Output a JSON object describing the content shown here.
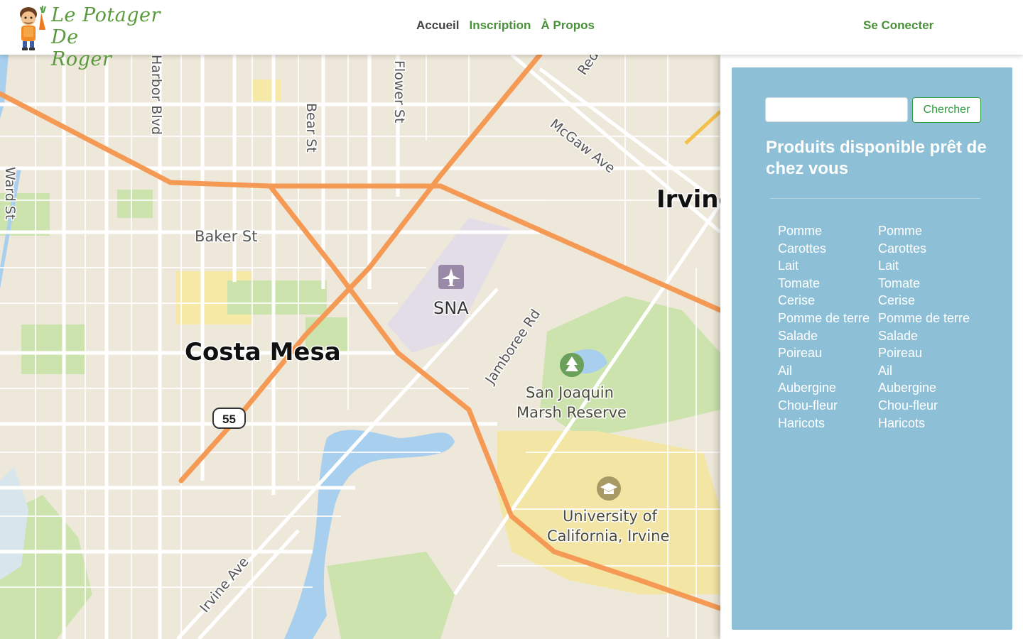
{
  "header": {
    "logo_line1": "Le Potager De",
    "logo_line2": "Roger",
    "nav": [
      {
        "label": "Accueil"
      },
      {
        "label": "Inscription"
      },
      {
        "label": "À Propos"
      }
    ],
    "login_label": "Se Conecter"
  },
  "map": {
    "labels": {
      "costa_mesa": "Costa Mesa",
      "irvine": "Irvine",
      "sna": "SNA",
      "baker": "Baker St",
      "harbor": "Harbor Blvd",
      "bear": "Bear St",
      "flower": "Flower St",
      "ward": "Ward St",
      "mcgaw": "McGaw Ave",
      "jamboree": "Jamboree Rd",
      "red": "Red",
      "irvine_ave": "Irvine Ave",
      "sj1": "San Joaquin",
      "sj2": "Marsh Reserve",
      "uci1": "University of",
      "uci2": "California, Irvine",
      "hwy": "55"
    }
  },
  "sidebar": {
    "search_placeholder": "",
    "search_button": "Chercher",
    "title": "Produits disponible prêt de chez vous",
    "products_col1": [
      "Pomme",
      "Carottes",
      "Lait",
      "Tomate",
      "Cerise",
      "Pomme de terre",
      "Salade",
      "Poireau",
      "Ail",
      "Aubergine",
      "Chou-fleur",
      "Haricots"
    ],
    "products_col2": [
      "Pomme",
      "Carottes",
      "Lait",
      "Tomate",
      "Cerise",
      "Pomme de terre",
      "Salade",
      "Poireau",
      "Ail",
      "Aubergine",
      "Chou-fleur",
      "Haricots"
    ]
  }
}
